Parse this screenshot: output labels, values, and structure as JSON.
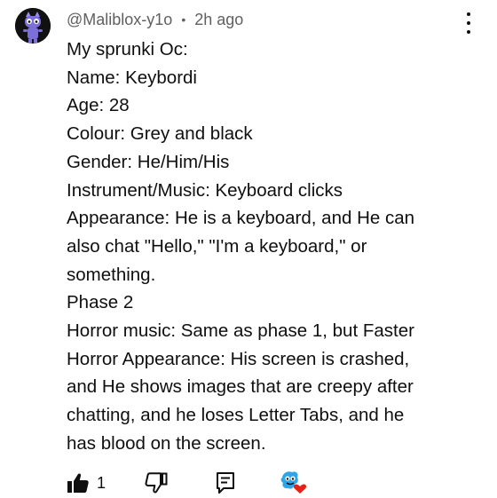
{
  "comment": {
    "username": "@Maliblox-y1o",
    "separator": "•",
    "timestamp": "2h ago",
    "lines": [
      "My sprunki Oc:",
      "Name: Keybordi",
      "Age: 28",
      "Colour: Grey and black",
      "Gender: He/Him/His",
      "Instrument/Music: Keyboard clicks",
      "Appearance: He is a keyboard, and He can",
      "also chat \"Hello,\" \"I'm a keyboard,\" or",
      "something.",
      "Phase 2",
      "Horror music: Same as phase 1, but Faster",
      "Horror Appearance: His screen is crashed,",
      "and He shows images that are creepy after",
      "chatting, and he loses Letter Tabs, and he",
      "has blood on the screen."
    ],
    "actions": {
      "like_count": "1"
    }
  },
  "icons": {
    "avatar": "sprunki-avatar",
    "more": "more-vert-icon",
    "like": "thumbs-up-filled-icon",
    "dislike": "thumbs-down-outline-icon",
    "reply": "reply-icon",
    "hearted": "creator-heart-badge"
  },
  "colors": {
    "text": "#0f0f0f",
    "meta": "#606060",
    "heart": "#e62117",
    "avatar_bg": "#111111",
    "avatar_figure": "#7b6fd8"
  }
}
